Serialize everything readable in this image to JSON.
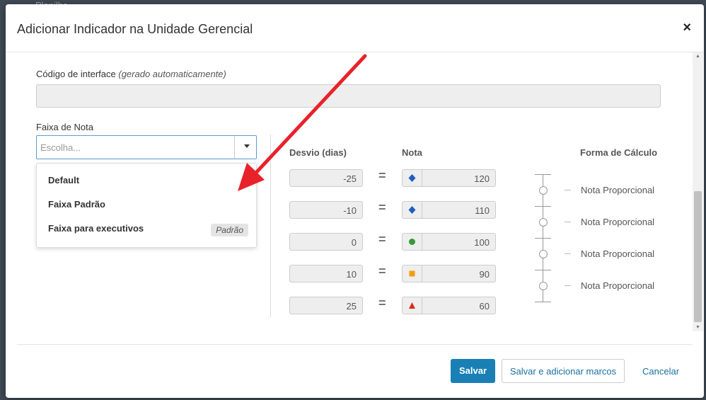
{
  "background": {
    "tab_label": "Planilha"
  },
  "modal": {
    "title": "Adicionar Indicador na Unidade Gerencial",
    "close_symbol": "×"
  },
  "interface_code": {
    "label": "Código de interface",
    "hint": "(gerado automaticamente)",
    "value": ""
  },
  "grade_range": {
    "label": "Faixa de Nota",
    "placeholder": "Escolha...",
    "options": [
      {
        "label": "Default"
      },
      {
        "label": "Faixa Padrão"
      },
      {
        "label": "Faixa para executivos",
        "badge": "Padrão"
      }
    ]
  },
  "table": {
    "headers": {
      "deviation": "Desvio (dias)",
      "grade": "Nota",
      "calc": "Forma de Cálculo"
    },
    "rows": [
      {
        "deviation": "-25",
        "grade": "120",
        "icon": "diamond-icon",
        "color": "#1f5fbf"
      },
      {
        "deviation": "-10",
        "grade": "110",
        "icon": "diamond-icon",
        "color": "#1f5fbf"
      },
      {
        "deviation": "0",
        "grade": "100",
        "icon": "circle-icon",
        "color": "#3a9a3a"
      },
      {
        "deviation": "10",
        "grade": "90",
        "icon": "square-icon",
        "color": "#f39c12"
      },
      {
        "deviation": "25",
        "grade": "60",
        "icon": "triangle-icon",
        "color": "#d62c1a"
      }
    ],
    "equals": "=",
    "calc_methods": [
      "Nota Proporcional",
      "Nota Proporcional",
      "Nota Proporcional",
      "Nota Proporcional"
    ]
  },
  "footer": {
    "save": "Salvar",
    "save_and_add": "Salvar e adicionar marcos",
    "cancel": "Cancelar"
  },
  "colors": {
    "primary": "#1a7fb5",
    "arrow": "#e8222b"
  }
}
